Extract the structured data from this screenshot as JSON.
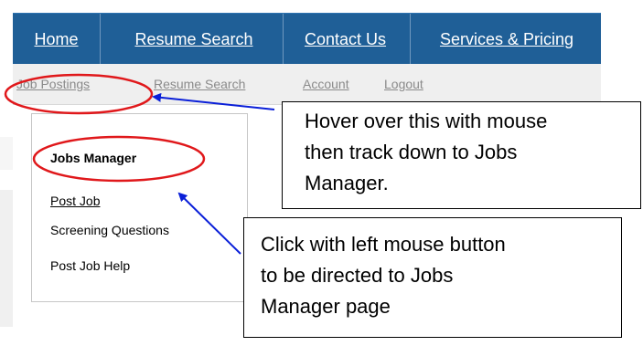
{
  "top_nav": {
    "items": [
      "Home",
      "Resume Search",
      "Contact Us",
      "Services & Pricing"
    ]
  },
  "sub_nav": {
    "items": [
      "Job Postings",
      "Resume Search",
      "Account",
      "Logout"
    ]
  },
  "dropdown_menu": {
    "items": [
      "Jobs Manager",
      "Post Job",
      "Screening Questions",
      "Post Job Help"
    ]
  },
  "callouts": {
    "hover": {
      "lines": [
        "Hover over this with mouse",
        "then track down to Jobs",
        "Manager."
      ]
    },
    "click": {
      "lines": [
        "Click with left mouse button",
        "to be directed to Jobs",
        "Manager page"
      ]
    }
  },
  "colors": {
    "nav_blue": "#1f5f97",
    "annotation_red": "#e0181b",
    "arrow_blue": "#0a1fd8"
  }
}
